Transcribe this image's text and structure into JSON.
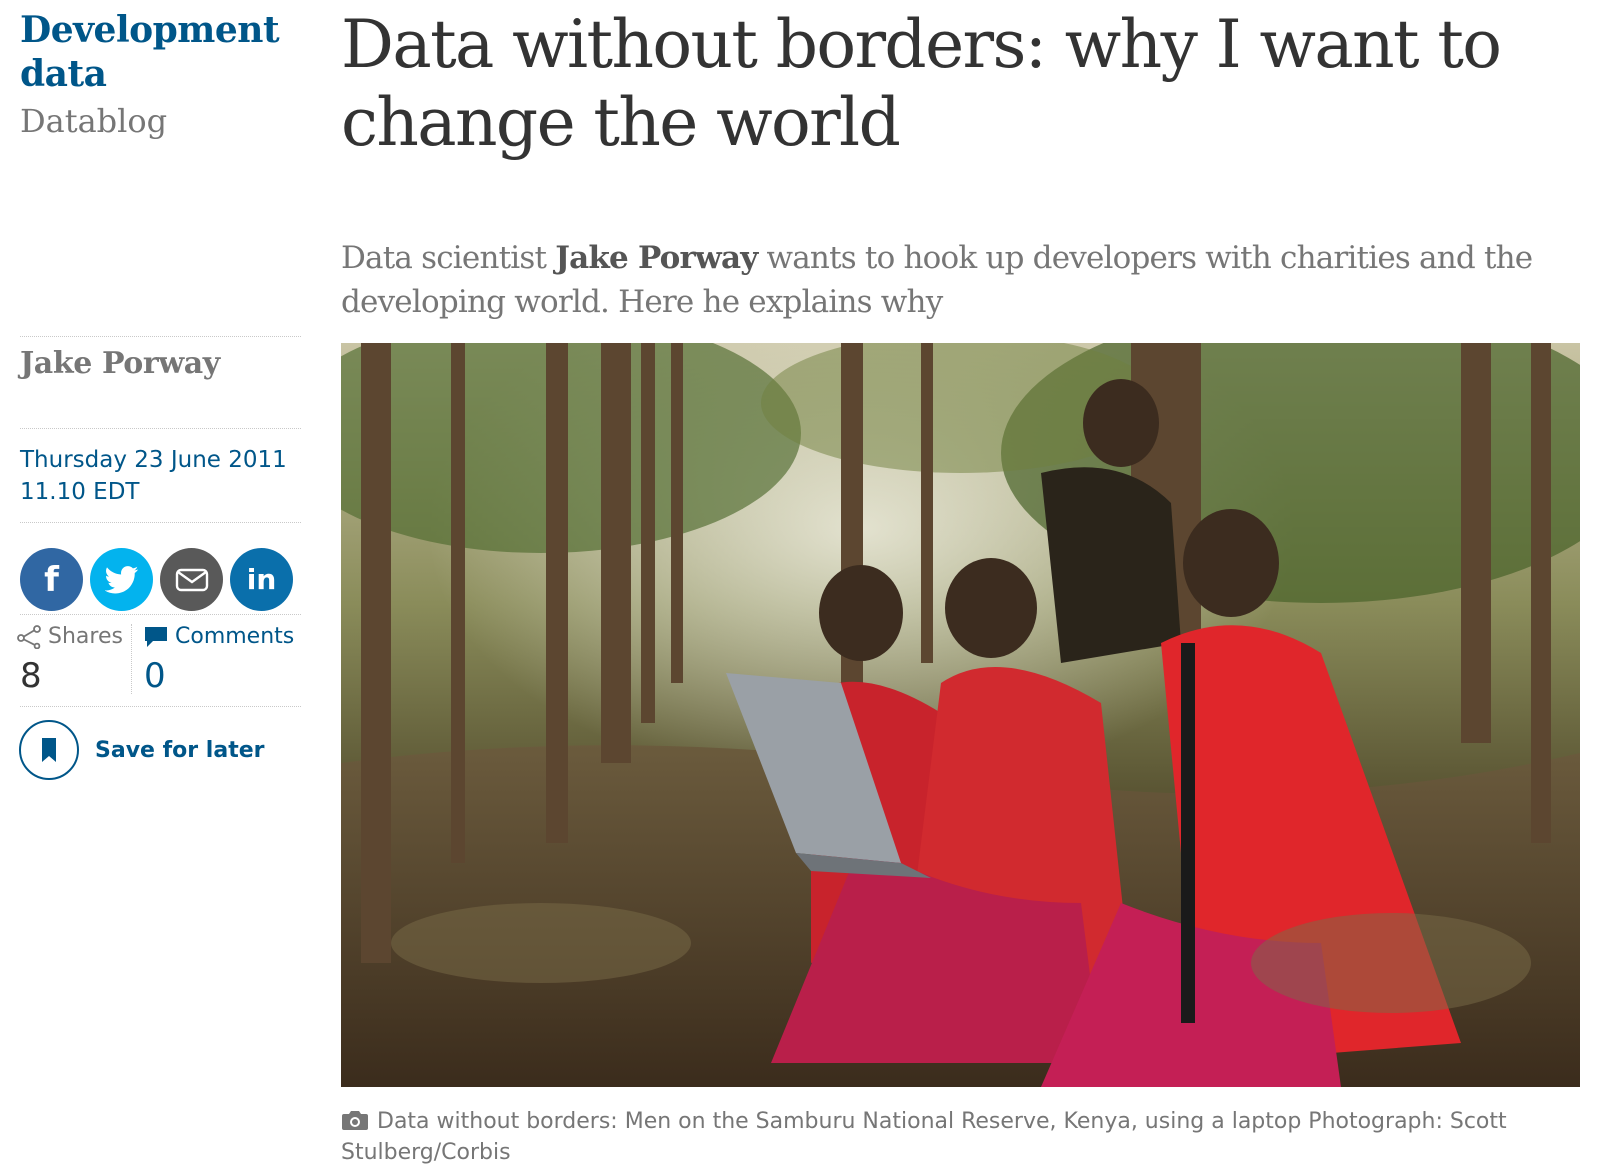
{
  "section": {
    "title": "Development data",
    "series": "Datablog"
  },
  "article": {
    "headline": "Data without borders: why I want to change the world",
    "standfirst": {
      "before": "Data scientist ",
      "author": "Jake Porway",
      "after": " wants to hook up developers with charities and the developing world. Here he explains why"
    },
    "byline": "Jake Porway",
    "date": "Thursday 23 June 2011",
    "time": "11.10 EDT"
  },
  "share": {
    "buttons": [
      {
        "network": "facebook",
        "icon": "facebook-icon",
        "glyph": "f",
        "color": "#3067a3"
      },
      {
        "network": "twitter",
        "icon": "twitter-icon",
        "color": "#03b3ee"
      },
      {
        "network": "email",
        "icon": "email-icon",
        "color": "#595959"
      },
      {
        "network": "linkedin",
        "icon": "linkedin-icon",
        "glyph": "in",
        "color": "#0a6fab"
      }
    ],
    "shares_label": "Shares",
    "shares_count": "8",
    "comments_label": "Comments",
    "comments_count": "0"
  },
  "save": {
    "label": "Save for later",
    "icon": "bookmark-icon"
  },
  "image": {
    "caption": "Data without borders: Men on the Samburu National Reserve, Kenya, using a laptop Photograph: Scott Stulberg/Corbis",
    "caption_icon": "camera-icon"
  },
  "colors": {
    "brand": "#005689",
    "text_grey": "#767676",
    "headline": "#333333"
  }
}
